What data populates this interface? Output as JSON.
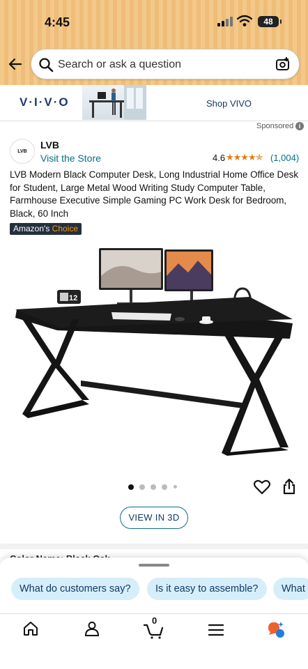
{
  "status_bar": {
    "time": "4:45",
    "battery": "48"
  },
  "search": {
    "placeholder": "Search or ask a question"
  },
  "banner": {
    "brand_logo": "V·I·V·O",
    "cta": "Shop VIVO",
    "sponsored": "Sponsored"
  },
  "store": {
    "logo_text": "LVB",
    "brand": "LVB",
    "visit": "Visit the Store",
    "rating": "4.6",
    "stars": "★★★★✯",
    "rating_count": "(1,004)"
  },
  "product": {
    "title": "LVB Modern Black Computer Desk, Long Industrial Home Office Desk for Student, Large Metal Wood Writing Study Computer Table, Farmhouse Executive Simple Gaming PC Work Desk for Bedroom, Black, 60 Inch",
    "badge_prefix": "Amazon's",
    "badge_suffix": "Choice",
    "clock_digits": "12",
    "image_count": 5,
    "active_image": 1
  },
  "actions": {
    "view_3d": "VIEW IN 3D"
  },
  "section_peek": "Color Name: Black Oak",
  "questions": [
    "What do customers say?",
    "Is it easy to assemble?",
    "What"
  ],
  "icons": {
    "back": "back-arrow-icon",
    "search": "search-icon",
    "camera": "camera-icon",
    "info": "info-icon",
    "heart": "heart-icon",
    "share": "share-icon",
    "home": "home-icon",
    "account": "account-icon",
    "cart": "cart-icon",
    "menu": "menu-icon",
    "rufus": "rufus-icon"
  },
  "cart_count": "0",
  "colors": {
    "header": "#f3c98a",
    "link": "#007185",
    "star": "#e37d10",
    "chip": "#d6eefa",
    "badge": "#232f3e"
  }
}
